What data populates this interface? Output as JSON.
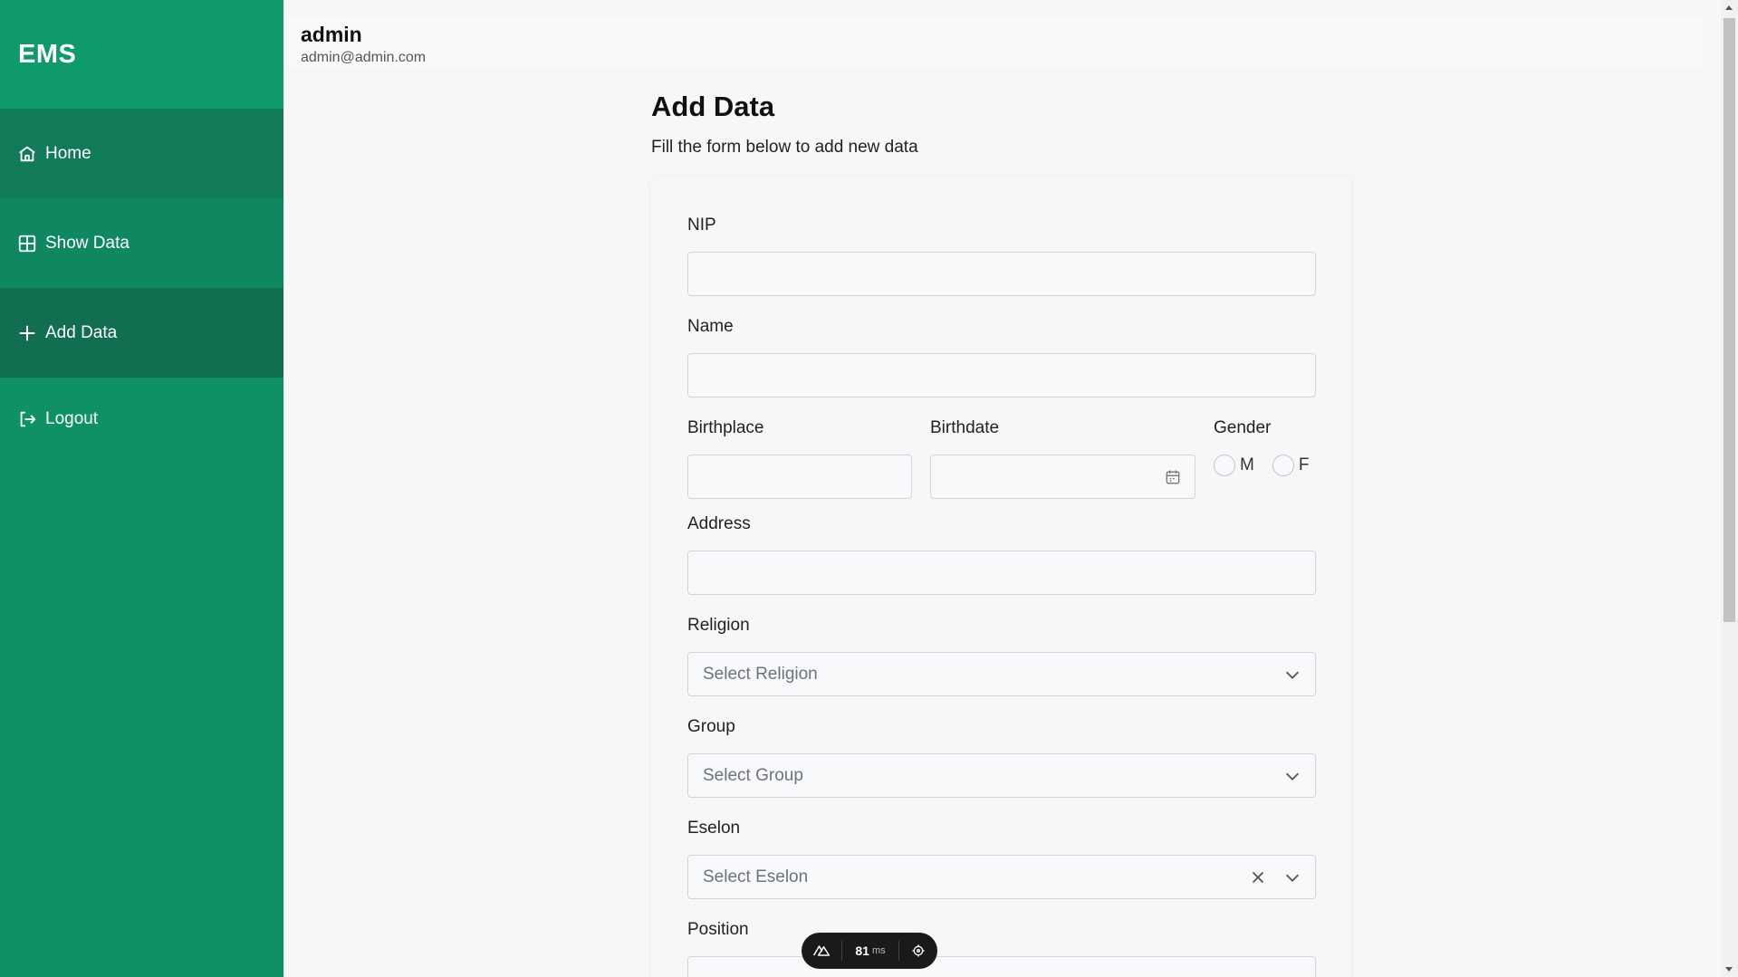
{
  "sidebar": {
    "brand": "EMS",
    "items": [
      {
        "label": "Home",
        "icon": "home-icon"
      },
      {
        "label": "Show Data",
        "icon": "table-icon"
      },
      {
        "label": "Add Data",
        "icon": "plus-icon"
      },
      {
        "label": "Logout",
        "icon": "logout-icon"
      }
    ]
  },
  "header": {
    "user_name": "admin",
    "user_email": "admin@admin.com"
  },
  "page": {
    "title": "Add Data",
    "subtitle": "Fill the form below to add new data"
  },
  "form": {
    "nip": {
      "label": "NIP",
      "value": ""
    },
    "name": {
      "label": "Name",
      "value": ""
    },
    "birthplace": {
      "label": "Birthplace",
      "value": ""
    },
    "birthdate": {
      "label": "Birthdate",
      "value": ""
    },
    "gender": {
      "label": "Gender",
      "options": [
        "M",
        "F"
      ],
      "selected": null
    },
    "address": {
      "label": "Address",
      "value": ""
    },
    "religion": {
      "label": "Religion",
      "placeholder": "Select Religion"
    },
    "group": {
      "label": "Group",
      "placeholder": "Select Group"
    },
    "eselon": {
      "label": "Eselon",
      "placeholder": "Select Eselon"
    },
    "position": {
      "label": "Position",
      "value": ""
    }
  },
  "devtools": {
    "timing_value": "81",
    "timing_unit": "ms"
  },
  "colors": {
    "sidebar": "#0f9163",
    "active_item": "#116e50"
  }
}
